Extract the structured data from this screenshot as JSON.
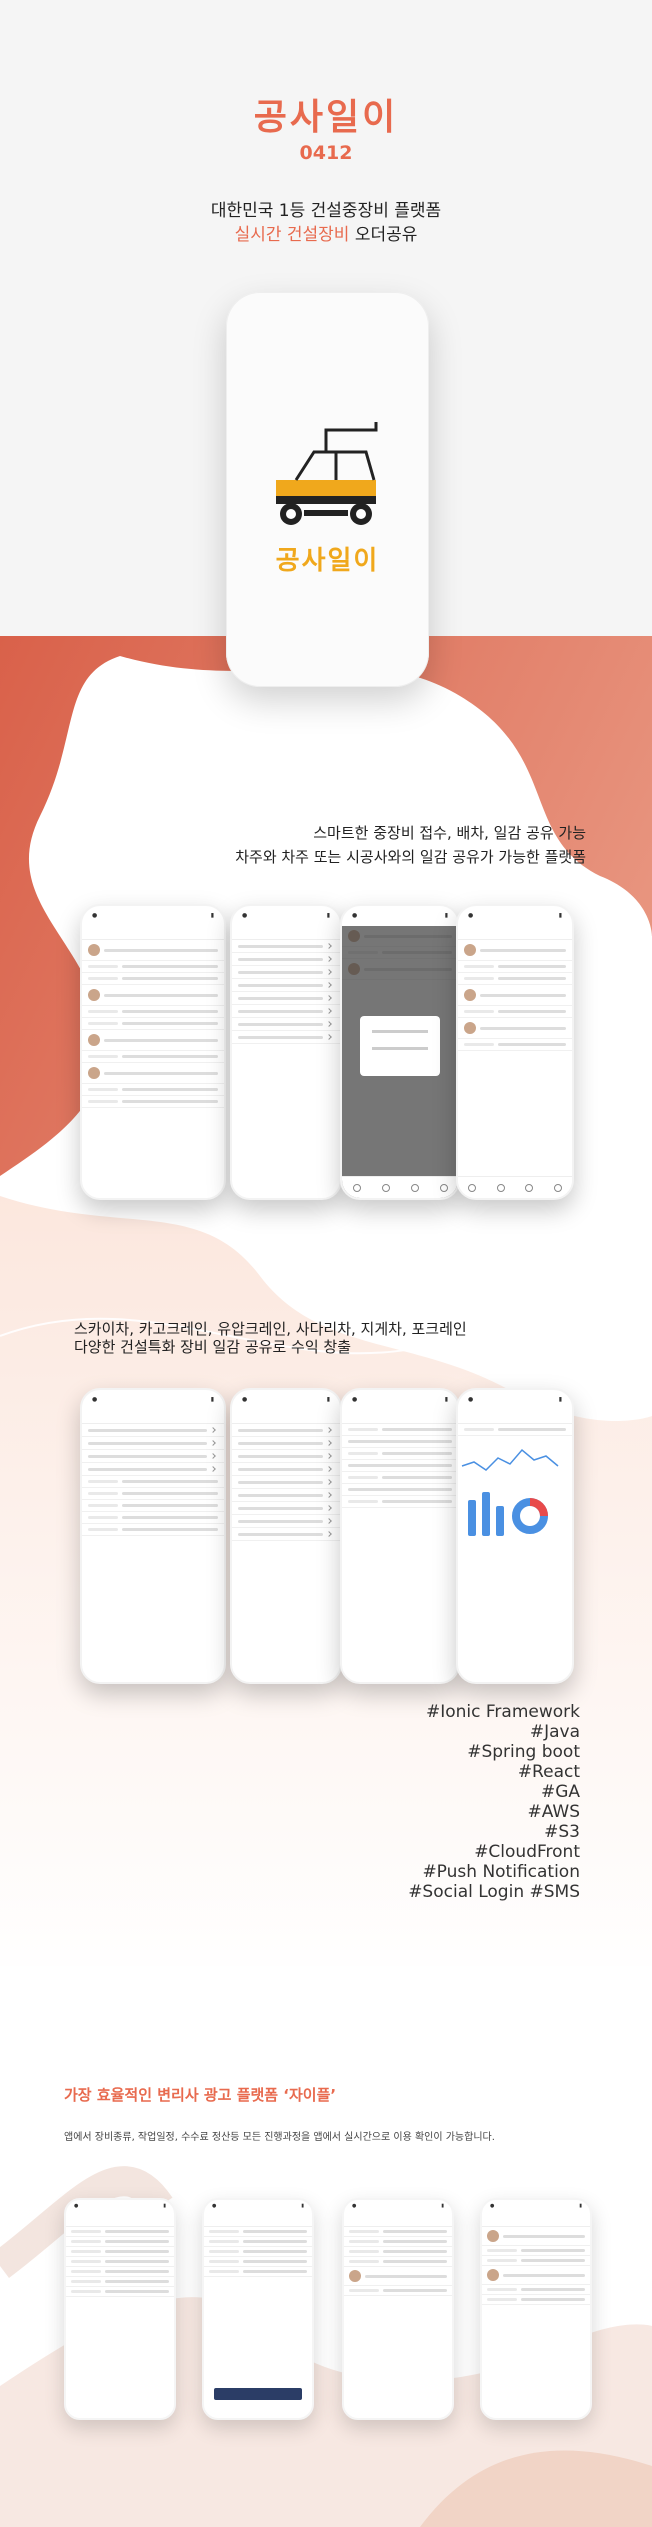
{
  "hero": {
    "title": "공사일이",
    "code": "0412",
    "subtitle_line1": "대한민국 1등 건설중장비 플랫폼",
    "subtitle_line2_highlight": "실시간 건설장비",
    "subtitle_line2_rest": " 오더공유",
    "logo_text": "공사일이"
  },
  "feature1": {
    "line1": "스마트한 중장비 접수, 배차, 일감 공유 가능",
    "line2": "차주와 차주 또는 시공사와의 일감 공유가 가능한 플랫폼"
  },
  "feature2": {
    "line1": "스카이차, 카고크레인, 유압크레인, 사다리차, 지게차, 포크레인",
    "line2": "다양한 건설특화 장비 일감 공유로 수익 창출"
  },
  "tech_tags": [
    "#Ionic Framework",
    "#Java",
    "#Spring boot",
    "#React",
    "#GA",
    "#AWS",
    "#S3",
    "#CloudFront",
    "#Push Notification",
    "#Social Login #SMS"
  ],
  "bottom": {
    "title": "가장 효율적인 변리사 광고 플랫폼 ‘자이플’",
    "description": "앱에서 장비종류, 작업일정, 수수료 정산등 모든 진행과정을 앱에서 실시간으로 이용 확인이 가능합니다."
  },
  "colors": {
    "accent": "#e86a4e",
    "logo_yellow": "#f0a81c",
    "band": "#d96b55"
  }
}
